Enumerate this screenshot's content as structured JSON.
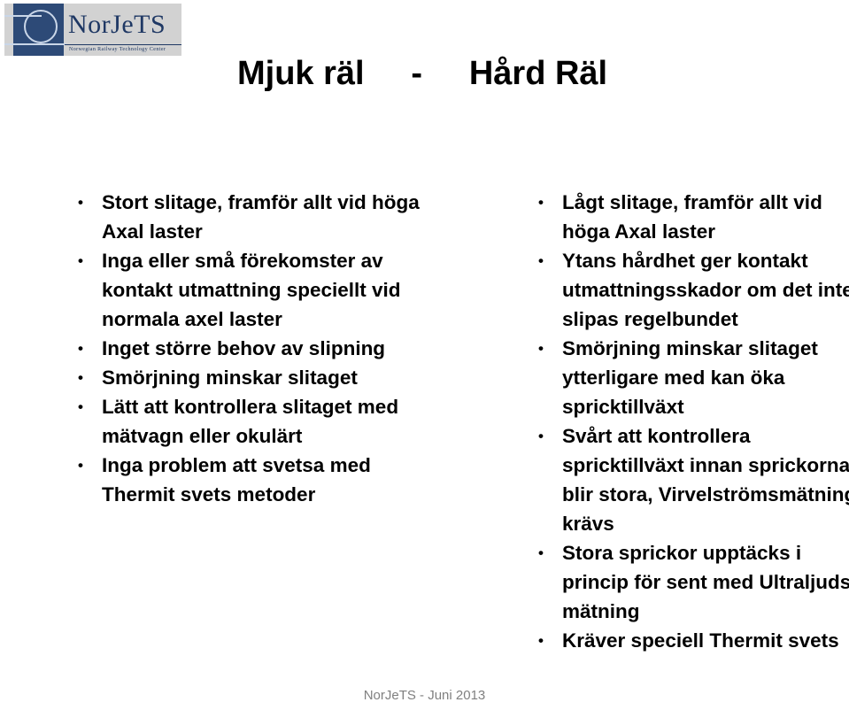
{
  "logo": {
    "wordmark": "NorJeTS",
    "tagline": "Norwegian Railway Technology Center",
    "mark_color": "#2d4a77",
    "background_color": "#d2d2d2",
    "text_color": "#1f3864"
  },
  "slide": {
    "title": "Mjuk räl     -     Hård Räl",
    "background_color": "#ffffff",
    "text_color": "#000000"
  },
  "columns": {
    "left": {
      "bullets": [
        "Stort slitage, framför allt vid höga Axal laster",
        "Inga eller små förekomster av kontakt utmattning speciellt vid normala axel laster",
        "Inget större behov av slipning",
        "Smörjning minskar slitaget",
        "Lätt att kontrollera slitaget med mätvagn eller okulärt",
        "Inga problem att svetsa med Thermit svets metoder"
      ]
    },
    "right": {
      "bullets": [
        "Lågt slitage, framför allt vid höga Axal laster",
        "Ytans hårdhet ger kontakt utmattningsskador om det inte slipas regelbundet",
        "Smörjning minskar slitaget ytterligare med kan öka spricktillväxt",
        "Svårt att kontrollera spricktillväxt innan sprickorna blir stora, Virvelströmsmätning krävs",
        "Stora sprickor upptäcks i princip för sent med Ultraljuds mätning",
        "Kräver speciell Thermit svets"
      ]
    }
  },
  "footer": {
    "text": "NorJeTS - Juni 2013",
    "color": "#808080"
  }
}
